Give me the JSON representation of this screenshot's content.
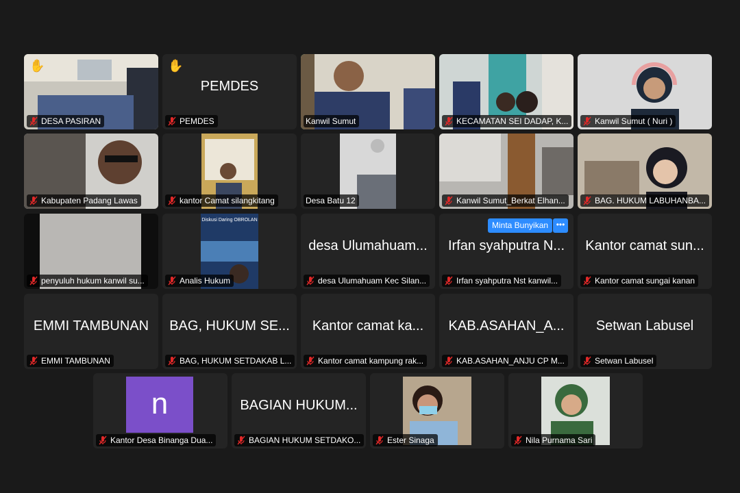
{
  "meeting": {
    "raised_hand_icon": "✋",
    "tiles": [
      {
        "name": "DESA PASIRAN",
        "big": "",
        "video": true,
        "hand": true
      },
      {
        "name": "PEMDES",
        "big": "PEMDES",
        "video": false,
        "hand": true
      },
      {
        "name": "Kanwil Sumut",
        "big": "",
        "video": true,
        "active": true
      },
      {
        "name": "KECAMATAN SEI DADAP, K...",
        "big": "",
        "video": true
      },
      {
        "name": "Kanwil Sumut ( Nuri )",
        "big": "",
        "video": true
      },
      {
        "name": "Kabupaten Padang Lawas",
        "big": "",
        "video": true
      },
      {
        "name": "kantor Camat silangkitang",
        "big": "",
        "video": true
      },
      {
        "name": "Desa Batu 12",
        "big": "",
        "video": true
      },
      {
        "name": "Kanwil Sumut_Berkat Elhan...",
        "big": "",
        "video": true
      },
      {
        "name": "BAG. HUKUM LABUHANBA...",
        "big": "",
        "video": true
      },
      {
        "name": "penyuluh hukum kanwil su...",
        "big": "",
        "video": true
      },
      {
        "name": "Analis Hukum",
        "big": "",
        "video": true,
        "slide_text": "Diskusi Daring OBROLAN"
      },
      {
        "name": "desa Ulumahuam Kec Silan...",
        "big": "desa Ulumahuam...",
        "video": false
      },
      {
        "name": "Irfan syahputra Nst kanwil...",
        "big": "Irfan syahputra N...",
        "video": false,
        "unmute": true
      },
      {
        "name": "Kantor camat sungai kanan",
        "big": "Kantor camat sun...",
        "video": false
      },
      {
        "name": "EMMI TAMBUNAN",
        "big": "EMMI TAMBUNAN",
        "video": false
      },
      {
        "name": "BAG, HUKUM SETDAKAB L...",
        "big": "BAG, HUKUM SE...",
        "video": false
      },
      {
        "name": "Kantor camat kampung rak...",
        "big": "Kantor camat ka...",
        "video": false
      },
      {
        "name": "KAB.ASAHAN_ANJU CP M...",
        "big": "KAB.ASAHAN_A...",
        "video": false
      },
      {
        "name": "Setwan Labusel",
        "big": "Setwan Labusel",
        "video": false
      },
      {
        "name": "Kantor Desa Binanga Dua...",
        "big": "",
        "video": false,
        "letter": "n"
      },
      {
        "name": "BAGIAN HUKUM SETDAKO...",
        "big": "BAGIAN HUKUM...",
        "video": false
      },
      {
        "name": "Ester Sinaga",
        "big": "",
        "video": true
      },
      {
        "name": "Nila Purnama Sari",
        "big": "",
        "video": true
      }
    ],
    "unmute_request_label": "Minta Bunyikan",
    "more_options_label": "•••"
  }
}
